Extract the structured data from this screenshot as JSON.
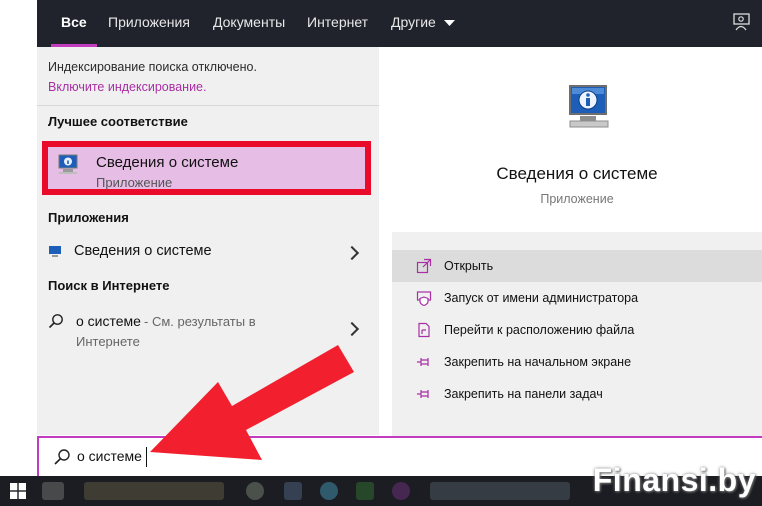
{
  "nav": {
    "tabs": [
      {
        "label": "Все"
      },
      {
        "label": "Приложения"
      },
      {
        "label": "Документы"
      },
      {
        "label": "Интернет"
      },
      {
        "label": "Другие"
      }
    ]
  },
  "left": {
    "index_notice": "Индексирование поиска отключено.",
    "enable_link": "Включите индексирование.",
    "best_match_header": "Лучшее соответствие",
    "best_match": {
      "title": "Сведения о системе",
      "subtitle": "Приложение"
    },
    "apps_header": "Приложения",
    "apps": [
      {
        "title": "Сведения о системе"
      }
    ],
    "web_header": "Поиск в Интернете",
    "web_result": {
      "query": "о системе",
      "hint": " - См. результаты в",
      "hint2": "Интернете"
    }
  },
  "right": {
    "title": "Сведения о системе",
    "subtitle": "Приложение",
    "actions": [
      {
        "label": "Открыть",
        "icon": "open-icon"
      },
      {
        "label": "Запуск от имени администратора",
        "icon": "shield-icon"
      },
      {
        "label": "Перейти к расположению файла",
        "icon": "file-location-icon"
      },
      {
        "label": "Закрепить на начальном экране",
        "icon": "pin-icon"
      },
      {
        "label": "Закрепить на панели задач",
        "icon": "pin-icon"
      }
    ]
  },
  "search": {
    "value": "о системе"
  },
  "watermark": "Finansi.by",
  "colors": {
    "accent": "#c33bbf",
    "highlight_border": "#ea0b2b",
    "arrow": "#f2202e",
    "nav_bg": "#20232c"
  }
}
